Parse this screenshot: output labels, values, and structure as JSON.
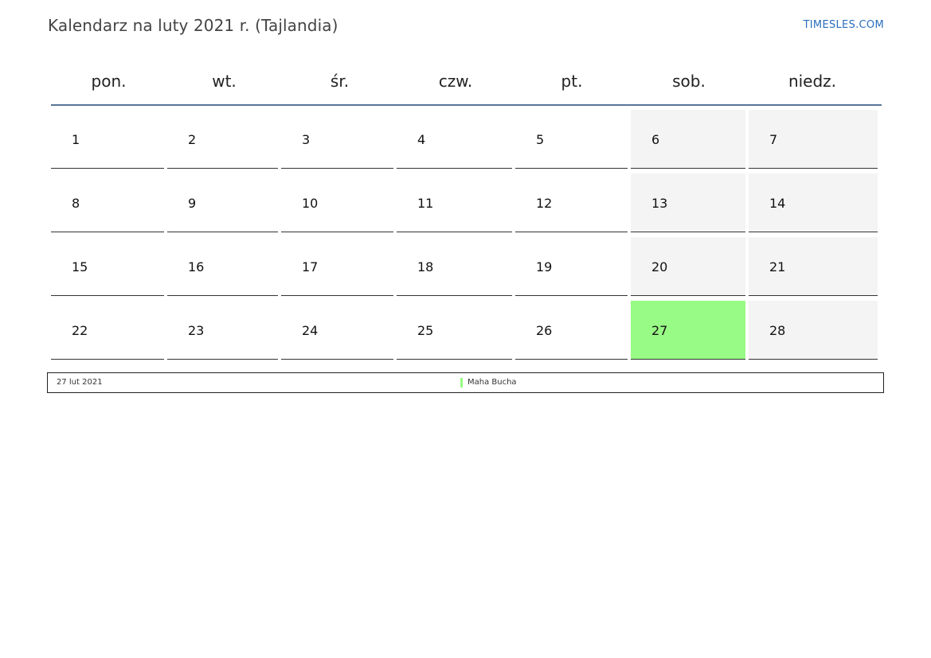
{
  "title": "Kalendarz na luty 2021 r. (Tajlandia)",
  "site_link": "TIMESLES.COM",
  "colors": {
    "header_rule": "#5a7496",
    "weekend_bg": "#f4f4f4",
    "holiday_bg": "#98fb85",
    "link": "#2a6ebb"
  },
  "weekdays": [
    "pon.",
    "wt.",
    "śr.",
    "czw.",
    "pt.",
    "sob.",
    "niedz."
  ],
  "weeks": [
    [
      {
        "day": "1"
      },
      {
        "day": "2"
      },
      {
        "day": "3"
      },
      {
        "day": "4"
      },
      {
        "day": "5"
      },
      {
        "day": "6",
        "weekend": true
      },
      {
        "day": "7",
        "weekend": true
      }
    ],
    [
      {
        "day": "8"
      },
      {
        "day": "9"
      },
      {
        "day": "10"
      },
      {
        "day": "11"
      },
      {
        "day": "12"
      },
      {
        "day": "13",
        "weekend": true
      },
      {
        "day": "14",
        "weekend": true
      }
    ],
    [
      {
        "day": "15"
      },
      {
        "day": "16"
      },
      {
        "day": "17"
      },
      {
        "day": "18"
      },
      {
        "day": "19"
      },
      {
        "day": "20",
        "weekend": true
      },
      {
        "day": "21",
        "weekend": true
      }
    ],
    [
      {
        "day": "22"
      },
      {
        "day": "23"
      },
      {
        "day": "24"
      },
      {
        "day": "25"
      },
      {
        "day": "26"
      },
      {
        "day": "27",
        "weekend": true,
        "holiday": true
      },
      {
        "day": "28",
        "weekend": true
      }
    ]
  ],
  "holidays": [
    {
      "date": "27 lut 2021",
      "name": "Maha Bucha"
    }
  ]
}
